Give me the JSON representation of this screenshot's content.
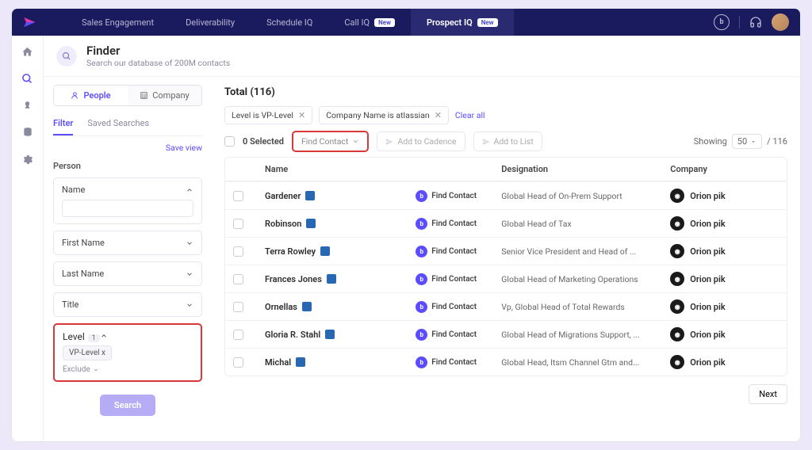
{
  "nav": {
    "items": [
      {
        "label": "Sales Engagement"
      },
      {
        "label": "Deliverability"
      },
      {
        "label": "Schedule IQ"
      },
      {
        "label": "Call IQ",
        "new": true
      },
      {
        "label": "Prospect IQ",
        "new": true,
        "active": true
      }
    ],
    "new_text": "New"
  },
  "header": {
    "title": "Finder",
    "subtitle": "Search our database of 200M contacts"
  },
  "filters": {
    "toggle": {
      "people": "People",
      "company": "Company"
    },
    "tabs": {
      "filter": "Filter",
      "saved": "Saved Searches"
    },
    "save_view": "Save view",
    "section": "Person",
    "items": {
      "name": "Name",
      "first_name": "First Name",
      "last_name": "Last Name",
      "title": "Title",
      "level": "Level",
      "level_count": "1",
      "level_chip": "VP-Level x",
      "exclude": "Exclude"
    },
    "search_btn": "Search"
  },
  "results": {
    "total_label": "Total (116)",
    "filter_chips": [
      "Level is VP-Level",
      "Company Name is atlassian"
    ],
    "clear_all": "Clear all",
    "selected": "0 Selected",
    "actions": {
      "find_contact": "Find Contact",
      "add_cadence": "Add to Cadence",
      "add_list": "Add to List"
    },
    "showing": "Showing",
    "page_size": "50",
    "total_count": "/ 116",
    "columns": {
      "name": "Name",
      "designation": "Designation",
      "company": "Company"
    },
    "find_label": "Find Contact",
    "rows": [
      {
        "name": "Gardener",
        "designation": "Global Head of On-Prem Support",
        "company": "Orion pik"
      },
      {
        "name": "Robinson",
        "designation": "Global Head of Tax",
        "company": "Orion pik"
      },
      {
        "name": "Terra Rowley",
        "designation": "Senior Vice President and Head of ...",
        "company": "Orion pik"
      },
      {
        "name": "Frances Jones",
        "designation": "Global Head of Marketing Operations",
        "company": "Orion pik"
      },
      {
        "name": "Ornellas",
        "designation": "Vp, Global Head of Total Rewards",
        "company": "Orion pik"
      },
      {
        "name": "Gloria R. Stahl",
        "designation": "Global Head of Migrations Support, ...",
        "company": "Orion pik"
      },
      {
        "name": "Michal",
        "designation": "Global Head, Itsm Channel Gtm and...",
        "company": "Orion pik"
      }
    ],
    "next": "Next"
  }
}
